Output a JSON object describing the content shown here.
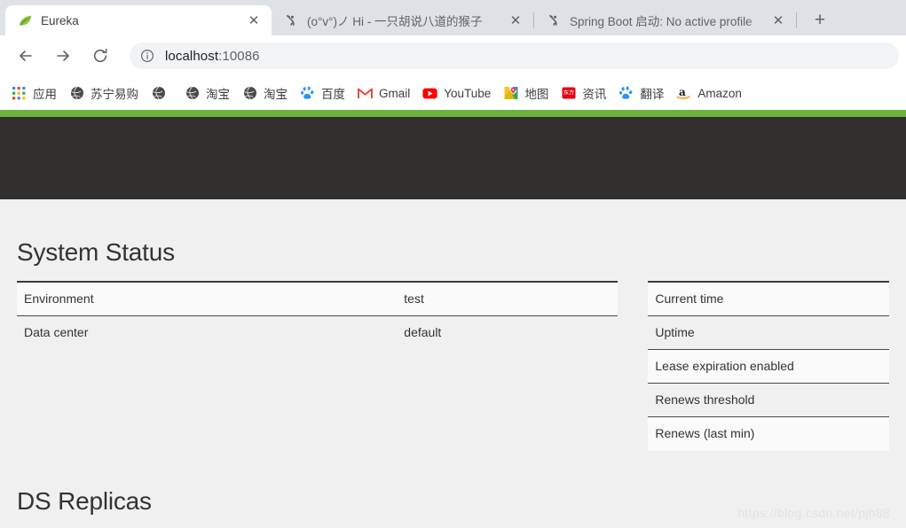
{
  "browser": {
    "tabs": [
      {
        "title": "Eureka",
        "favicon": "spring-leaf-icon",
        "active": true
      },
      {
        "title": "(o°v°)ノ Hi - 一只胡说八道的猴子",
        "favicon": "csdn-icon",
        "active": false
      },
      {
        "title": "Spring Boot 启动: No active profile",
        "favicon": "csdn-icon",
        "active": false
      }
    ],
    "new_tab_label": "+",
    "close_label": "✕",
    "toolbar": {
      "back_label": "←",
      "forward_label": "→",
      "reload_label": "⟳",
      "url_host": "localhost",
      "url_port": ":10086",
      "url_full": "localhost:10086"
    },
    "bookmarks": [
      {
        "label": "应用",
        "icon": "apps-grid-icon"
      },
      {
        "label": "苏宁易购",
        "icon": "globe-icon"
      },
      {
        "label": "",
        "icon": "globe-icon"
      },
      {
        "label": "淘宝",
        "icon": "globe-icon"
      },
      {
        "label": "淘宝",
        "icon": "globe-icon"
      },
      {
        "label": "百度",
        "icon": "baidu-icon"
      },
      {
        "label": "Gmail",
        "icon": "gmail-icon"
      },
      {
        "label": "YouTube",
        "icon": "youtube-icon"
      },
      {
        "label": "地图",
        "icon": "google-maps-icon"
      },
      {
        "label": "资讯",
        "icon": "dongfang-icon"
      },
      {
        "label": "翻译",
        "icon": "baidu-icon"
      },
      {
        "label": "Amazon",
        "icon": "amazon-icon"
      }
    ]
  },
  "page": {
    "theme": {
      "green_bar": "#6db33f",
      "header_bar": "#32302e",
      "background": "#f0f0f0"
    },
    "system_status": {
      "title": "System Status",
      "left_rows": [
        {
          "key": "Environment",
          "value": "test"
        },
        {
          "key": "Data center",
          "value": "default"
        }
      ],
      "right_rows": [
        {
          "key": "Current time",
          "value": ""
        },
        {
          "key": "Uptime",
          "value": ""
        },
        {
          "key": "Lease expiration enabled",
          "value": ""
        },
        {
          "key": "Renews threshold",
          "value": ""
        },
        {
          "key": "Renews (last min)",
          "value": ""
        }
      ]
    },
    "ds_replicas": {
      "title": "DS Replicas"
    },
    "watermark": "https://blog.csdn.net/pjh88"
  }
}
